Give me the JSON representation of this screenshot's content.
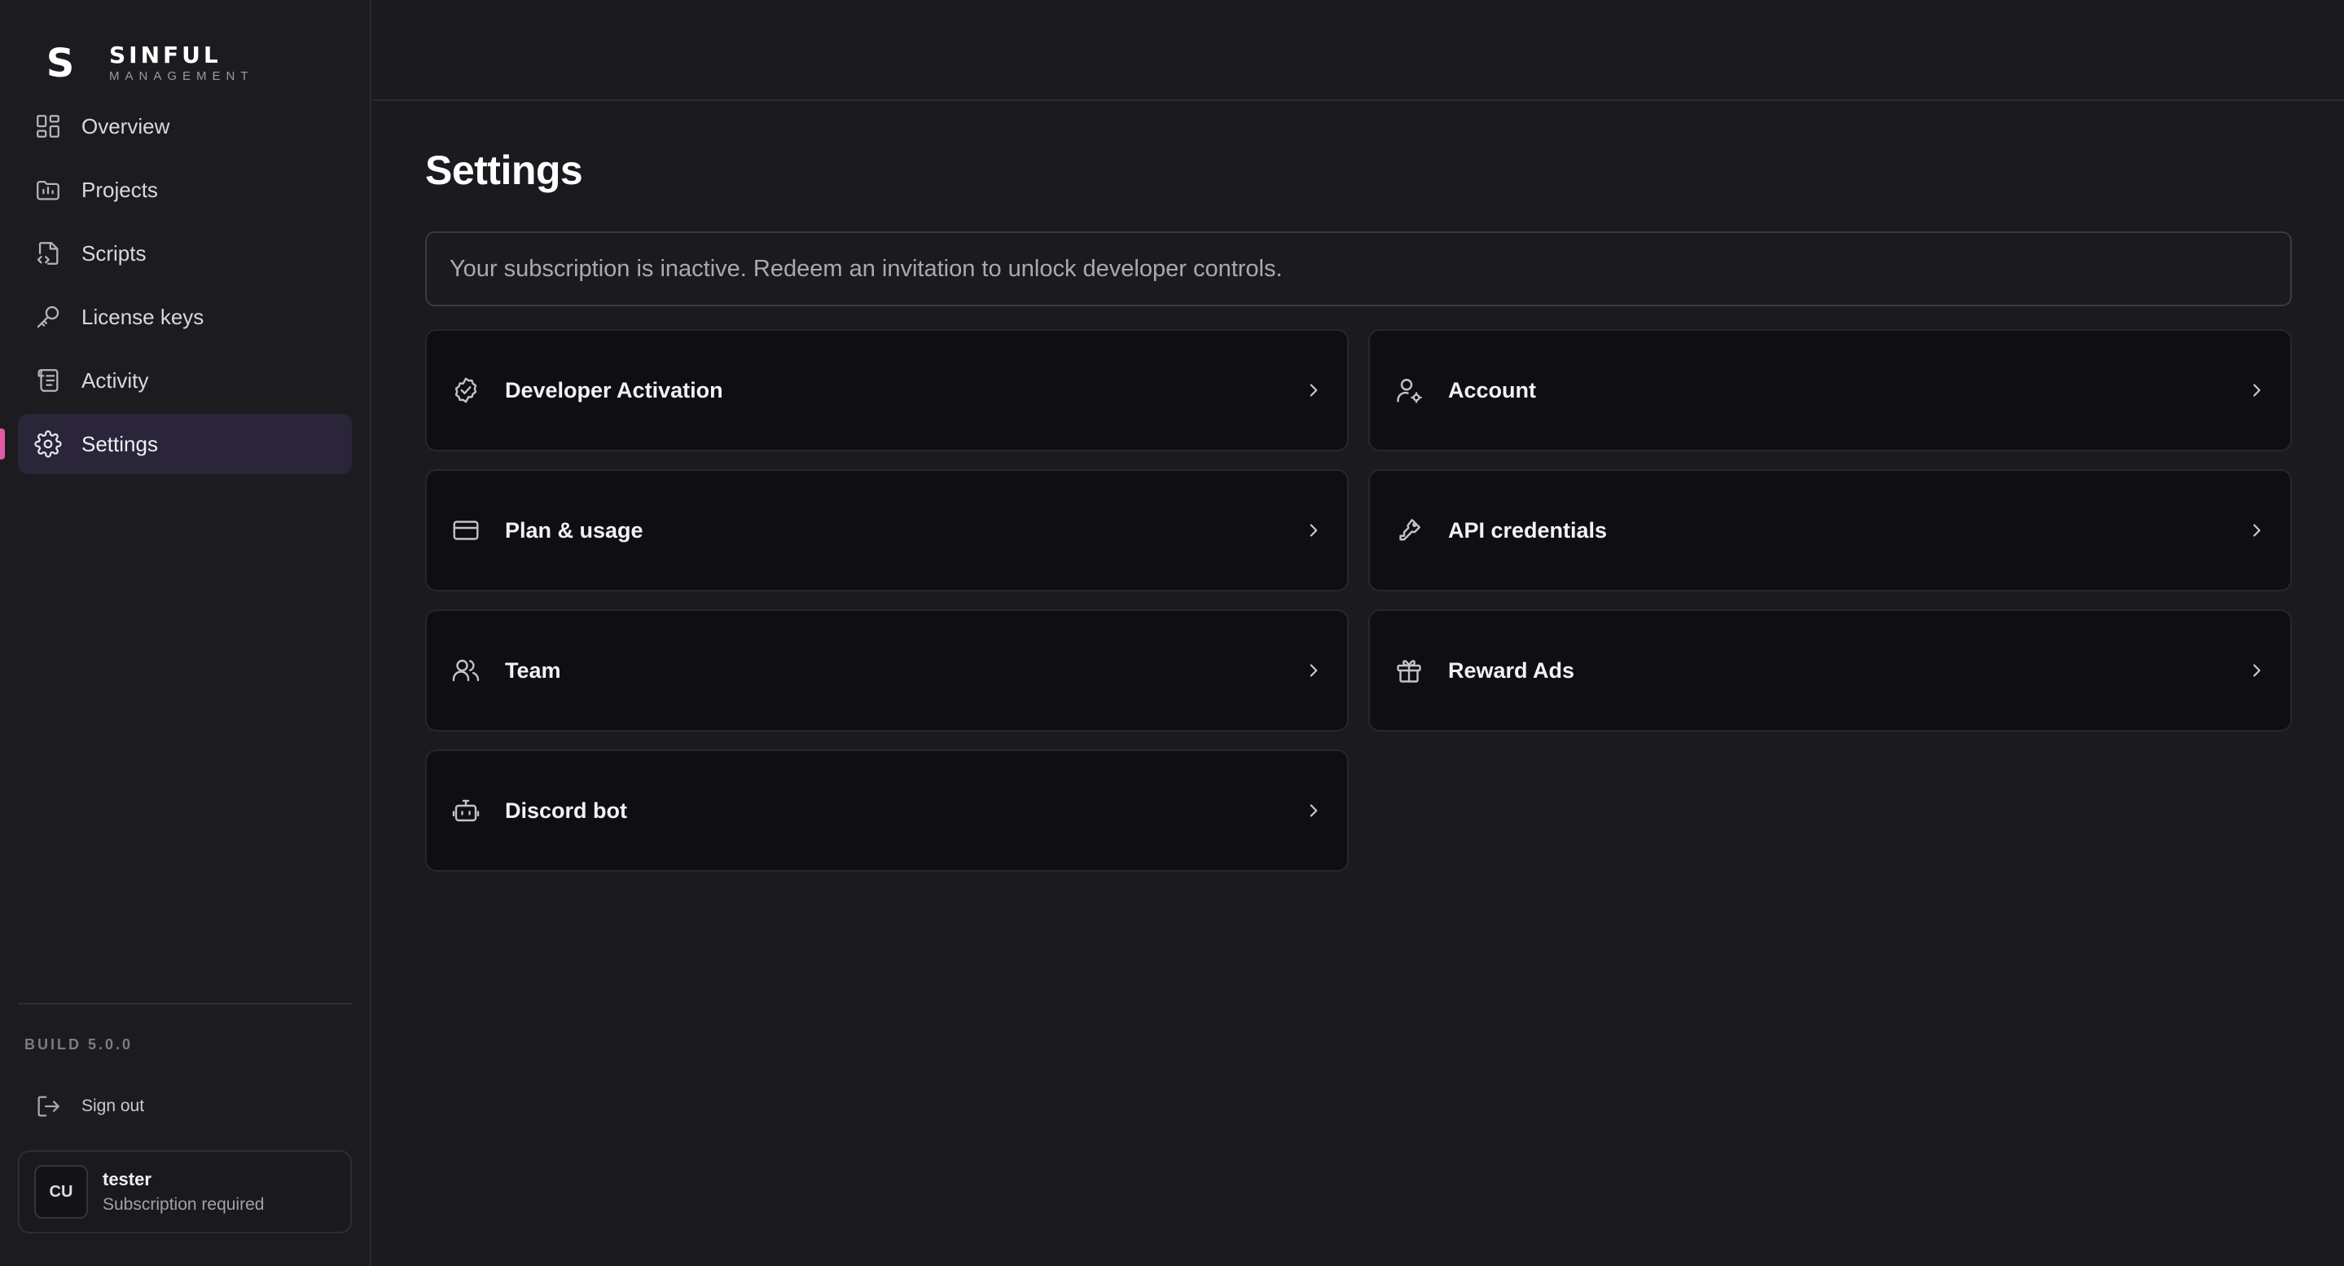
{
  "brand": {
    "mark": "S",
    "name": "SINFUL",
    "sub": "MANAGEMENT"
  },
  "sidebar": {
    "items": [
      {
        "label": "Overview",
        "icon": "grid-icon"
      },
      {
        "label": "Projects",
        "icon": "folder-icon"
      },
      {
        "label": "Scripts",
        "icon": "file-code-icon"
      },
      {
        "label": "License keys",
        "icon": "key-icon"
      },
      {
        "label": "Activity",
        "icon": "scroll-icon"
      },
      {
        "label": "Settings",
        "icon": "gear-icon",
        "active": true
      }
    ],
    "build": "BUILD 5.0.0",
    "signout": "Sign out",
    "user": {
      "initials": "CU",
      "name": "tester",
      "status": "Subscription required"
    }
  },
  "main": {
    "title": "Settings",
    "notice": "Your subscription is inactive. Redeem an invitation to unlock developer controls.",
    "cards": [
      {
        "label": "Developer Activation",
        "icon": "badge-check-icon"
      },
      {
        "label": "Account",
        "icon": "user-gear-icon"
      },
      {
        "label": "Plan & usage",
        "icon": "credit-card-icon"
      },
      {
        "label": "API credentials",
        "icon": "key-icon"
      },
      {
        "label": "Team",
        "icon": "users-icon"
      },
      {
        "label": "Reward Ads",
        "icon": "gift-icon"
      },
      {
        "label": "Discord bot",
        "icon": "bot-icon"
      }
    ]
  },
  "colors": {
    "accent": "#e35aa8",
    "active_bg": "#2a2538",
    "bg": "#1b1b1f",
    "card_bg": "#0f0f12"
  }
}
